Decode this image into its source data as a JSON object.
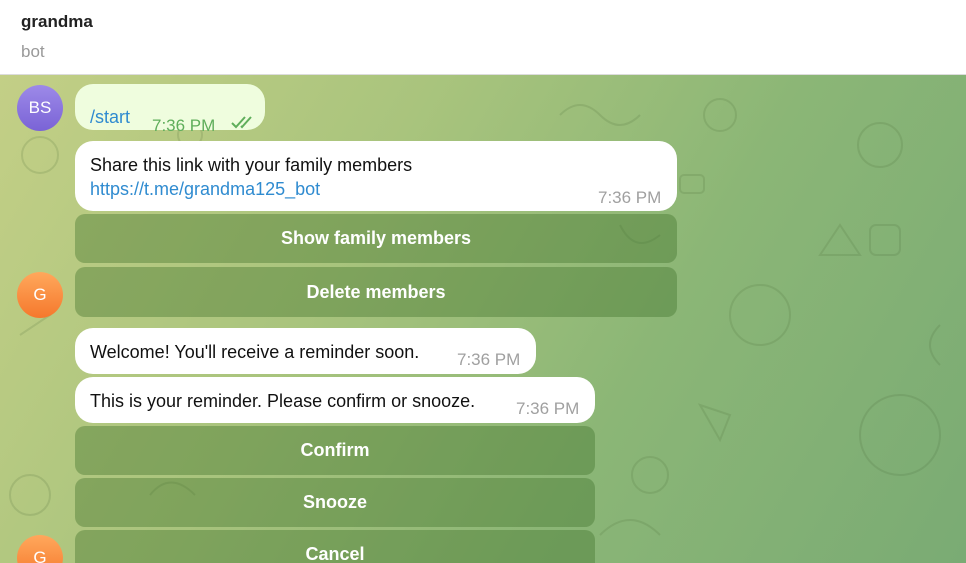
{
  "header": {
    "title": "grandma",
    "status": "bot"
  },
  "messages": {
    "start": {
      "avatar_initials": "BS",
      "text": "/start",
      "time": "7:36 PM"
    },
    "share": {
      "line1": "Share this link with your family members",
      "link": "https://t.me/grandma125_bot",
      "time": "7:36 PM"
    },
    "welcome": {
      "text": "Welcome! You'll receive a reminder soon.",
      "time": "7:36 PM"
    },
    "reminder": {
      "text": "This is your reminder. Please confirm or snooze.",
      "time": "7:36 PM"
    }
  },
  "bot_avatar_initial": "G",
  "keyboard1": {
    "show_members": "Show family members",
    "delete_members": "Delete members"
  },
  "keyboard2": {
    "confirm": "Confirm",
    "snooze": "Snooze",
    "cancel": "Cancel"
  },
  "colors": {
    "bot_avatar": "#f5782c",
    "user_avatar": "#7a63d6",
    "link": "#2f8bd0",
    "read_check": "#5fae5b"
  }
}
